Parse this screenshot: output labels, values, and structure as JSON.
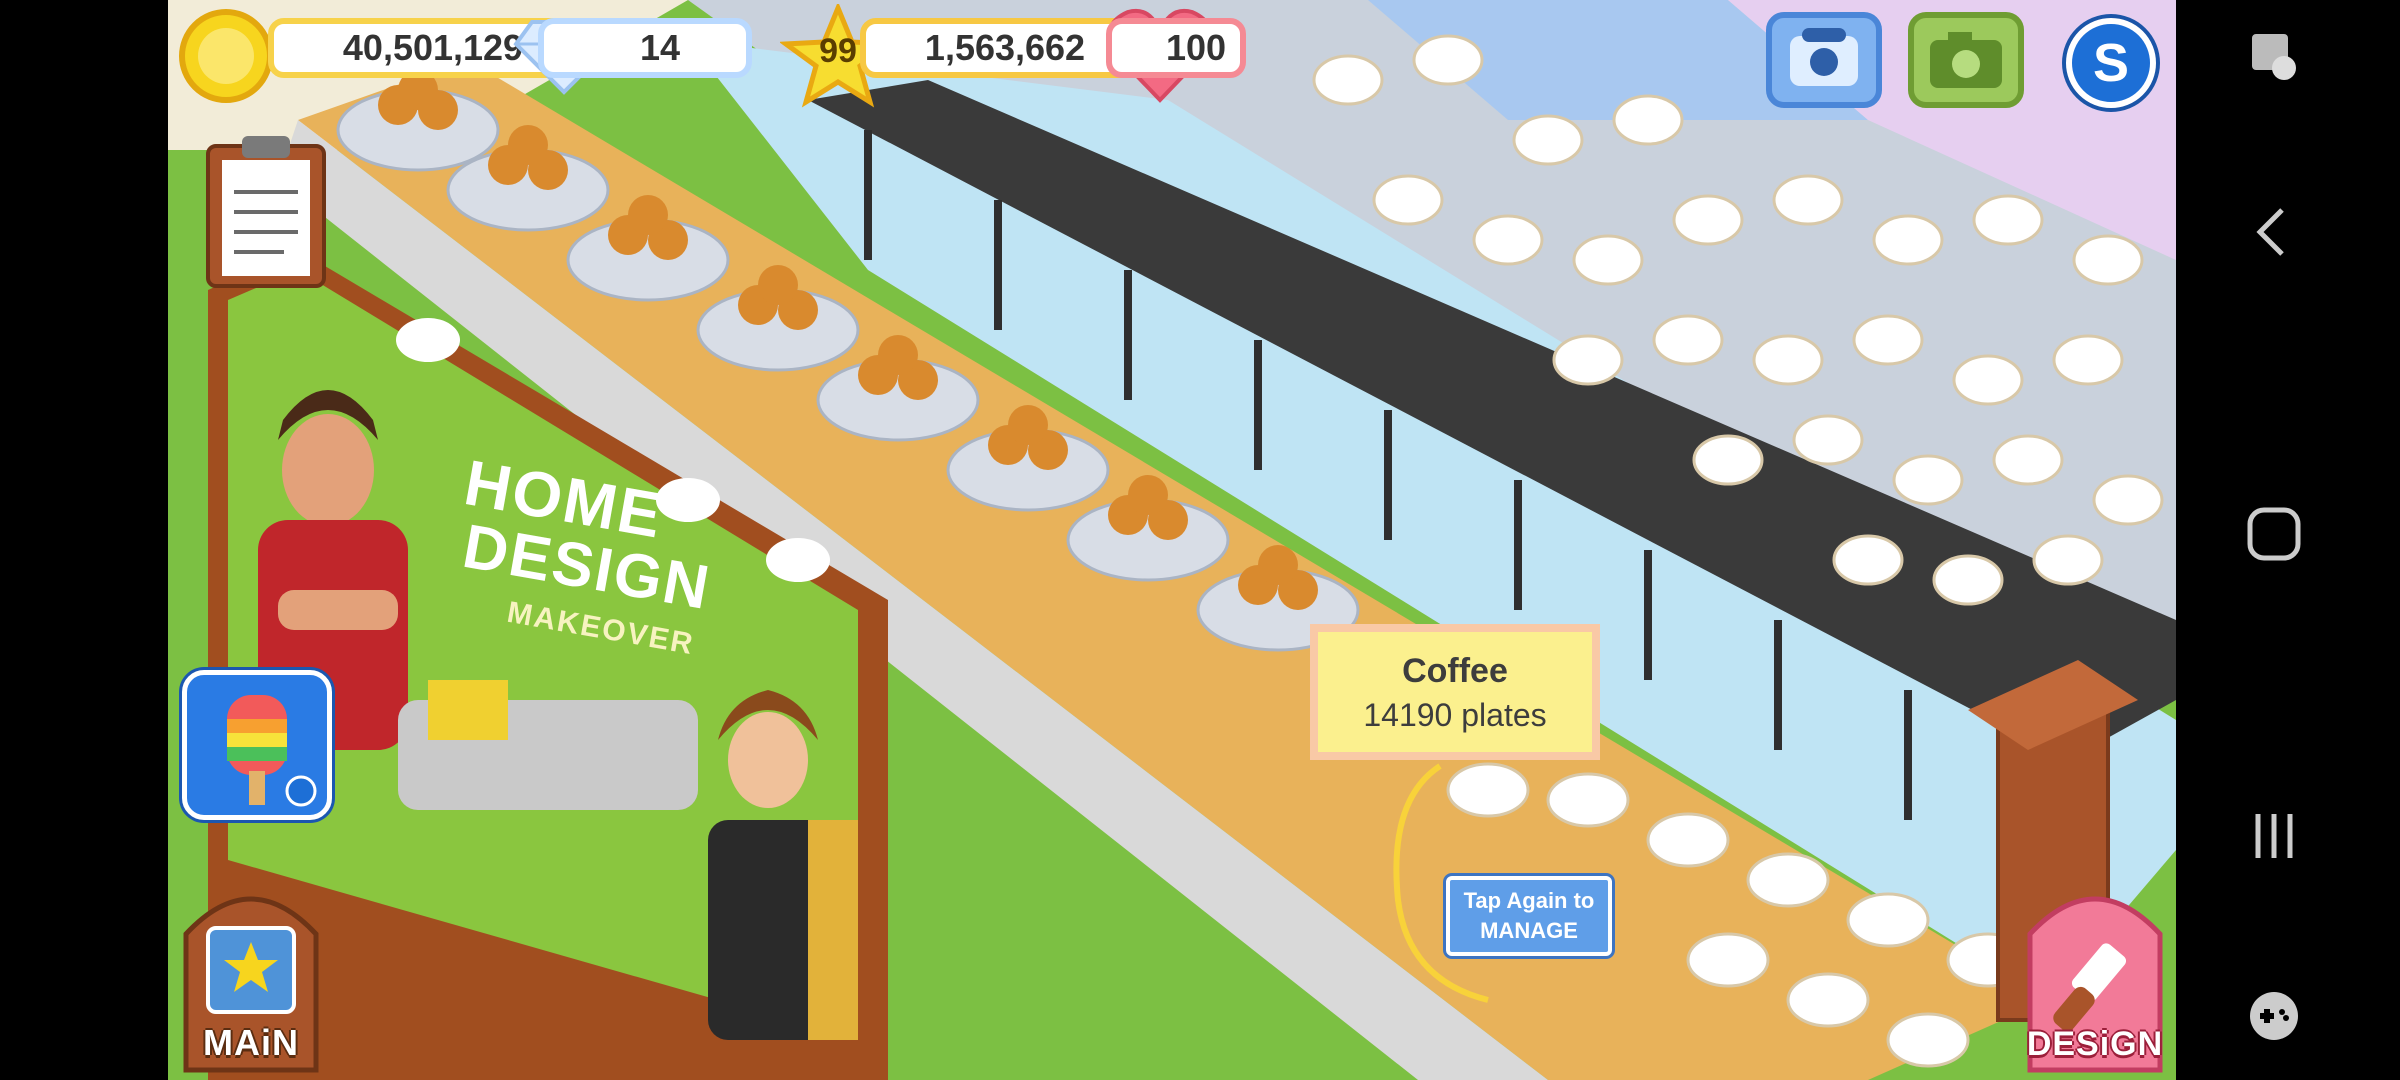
{
  "hud": {
    "coins": "40,501,129",
    "gems": "14",
    "level": "99",
    "xp": "1,563,662",
    "hearts": "100"
  },
  "tooltip": {
    "title": "Coffee",
    "subtitle": "14190 plates"
  },
  "manage_button": {
    "line1": "Tap Again to",
    "line2": "MANAGE"
  },
  "buttons": {
    "main_label": "MAiN",
    "design_label": "DESiGN",
    "s_badge": "S"
  },
  "billboard": {
    "line1": "HOME",
    "line2": "DESIGN",
    "line3": "MAKEOVER"
  },
  "colors": {
    "grass": "#7cc043",
    "counter_wood": "#e8b25a",
    "rail_dark": "#3a3a3a",
    "floor_tile": "#bfc9d6",
    "tooltip_bg": "#fbf08e"
  },
  "navbar_icons": [
    "accessibility-icon",
    "back-icon",
    "home-icon",
    "recents-icon",
    "game-controller-icon"
  ]
}
